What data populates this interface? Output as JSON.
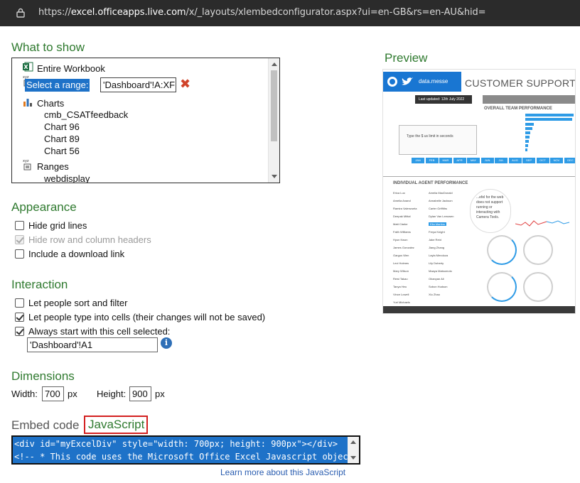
{
  "browser": {
    "url_scheme": "https://",
    "url_host": "excel.officeapps.live.com",
    "url_path": "/x/_layouts/xlembedconfigurator.aspx?ui=en-GB&rs=en-AU&hid="
  },
  "what_to_show": {
    "heading": "What to show",
    "items": {
      "entire_workbook": "Entire Workbook",
      "select_range_label": "Select a range:",
      "select_range_value": "'Dashboard'!A:XF",
      "charts": "Charts",
      "chart1": "cmb_CSATfeedback",
      "chart2": "Chart 96",
      "chart3": "Chart 89",
      "chart4": "Chart 56",
      "ranges": "Ranges",
      "range1": "webdisplay"
    }
  },
  "appearance": {
    "heading": "Appearance",
    "hide_grid": "Hide grid lines",
    "hide_headers": "Hide row and column headers",
    "download_link": "Include a download link"
  },
  "interaction": {
    "heading": "Interaction",
    "sort_filter": "Let people sort and filter",
    "type_cells": "Let people type into cells (their changes will not be saved)",
    "start_cell": "Always start with this cell selected:",
    "start_cell_value": "'Dashboard'!A1"
  },
  "dimensions": {
    "heading": "Dimensions",
    "width_label": "Width:",
    "width_value": "700",
    "width_unit": "px",
    "height_label": "Height:",
    "height_value": "900",
    "height_unit": "px"
  },
  "embed": {
    "label": "Embed code",
    "tab": "JavaScript",
    "code_line1": "<div id=\"myExcelDiv\" style=\"width: 700px; height: 900px\"></div>",
    "code_line2": "<!-- * This code uses the Microsoft Office Excel Javascript object model to",
    "learn_more": "Learn more about this JavaScript"
  },
  "preview": {
    "heading": "Preview",
    "banner_text": "data.messe",
    "title": "CUSTOMER SUPPORT A",
    "last_updated": "Last updated: 12th July 2022",
    "overall": "OVERALL TEAM PERFORMANCE",
    "individual": "INDIVIDUAL AGENT PERFORMANCE",
    "tooltip": "Type the $ us limit in seconds",
    "note": "...efel for the web does not support running or interacting with Camera Tools.",
    "months": [
      "JAN",
      "FEB",
      "MAR",
      "APR",
      "MAY",
      "JUN",
      "JUL",
      "AUG",
      "SEP",
      "OCT",
      "NOV",
      "DEC"
    ],
    "agents_col1": [
      "Erica Luo",
      "Amelia Anand",
      "Ramira Valenzuela",
      "Deepak Mittal",
      "Matt Clarke",
      "Faith Williams",
      "Hyun Kwon",
      "James Gonzalez",
      "Gargus Wen",
      "Levi Holmes",
      "Mary Wilson",
      "Rewi Takao",
      "Tanya Heu",
      "Vince Lowell",
      "Yuri Michaels"
    ],
    "agents_col2": [
      "Amelia MacDonald",
      "Annabelle Jackson",
      "Carter Griffiths",
      "Dylan Van Leeuwen",
      "Ella Martins",
      "Freya Knight",
      "Jake Reid",
      "Jiang Zhang",
      "Layla Mendoza",
      "Lily Doherty",
      "Maaya Matsumoto",
      "Obanyan Ali",
      "Sobon Hudson",
      "Xiu Zhao"
    ],
    "colors": {
      "accent": "#1e72c8",
      "heading_green": "#2f7a2f",
      "preview_blue": "#2e9be6"
    }
  }
}
